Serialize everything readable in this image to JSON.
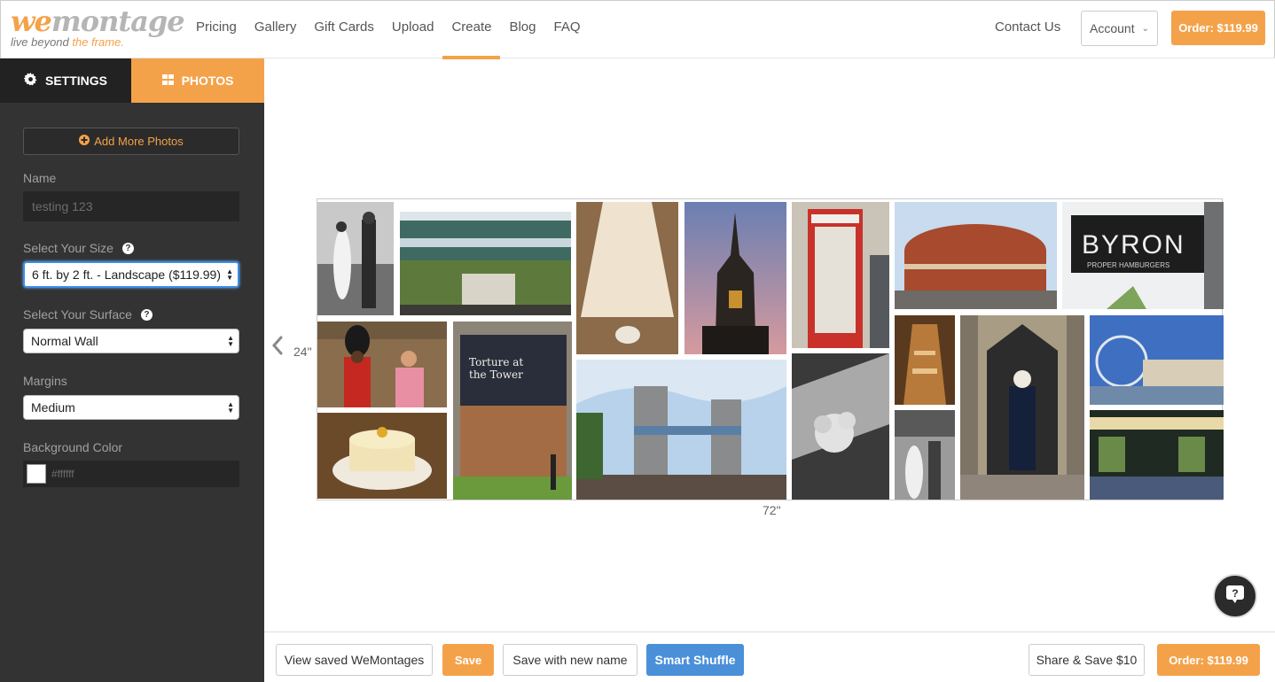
{
  "header": {
    "logo": {
      "brand_we": "we",
      "brand_montage": "montage",
      "tagline_pre": "live beyond ",
      "tagline_hl": "the frame."
    },
    "nav": [
      {
        "label": "Pricing"
      },
      {
        "label": "Gallery"
      },
      {
        "label": "Gift Cards"
      },
      {
        "label": "Upload"
      },
      {
        "label": "Create",
        "active": true
      },
      {
        "label": "Blog"
      },
      {
        "label": "FAQ"
      }
    ],
    "contact": "Contact Us",
    "account": "Account",
    "order": "Order: $119.99"
  },
  "sidebar": {
    "tabs": {
      "settings": "SETTINGS",
      "photos": "PHOTOS"
    },
    "add_photos": "Add More Photos",
    "name_label": "Name",
    "name_value": "testing 123",
    "size_label": "Select Your Size",
    "size_value": "6 ft. by 2 ft. - Landscape ($119.99)",
    "surface_label": "Select Your Surface",
    "surface_value": "Normal Wall",
    "margins_label": "Margins",
    "margins_value": "Medium",
    "bg_label": "Background Color",
    "bg_value": "#ffffff"
  },
  "canvas": {
    "height_label": "24\"",
    "width_label": "72\""
  },
  "footer": {
    "view_saved": "View saved WeMontages",
    "save": "Save",
    "save_new": "Save with new name",
    "smart_shuffle": "Smart Shuffle",
    "share_save": "Share & Save $10",
    "order": "Order: $119.99"
  },
  "colors": {
    "accent": "#f4a24a",
    "sidebar": "#333333",
    "blue": "#4a90d9"
  }
}
